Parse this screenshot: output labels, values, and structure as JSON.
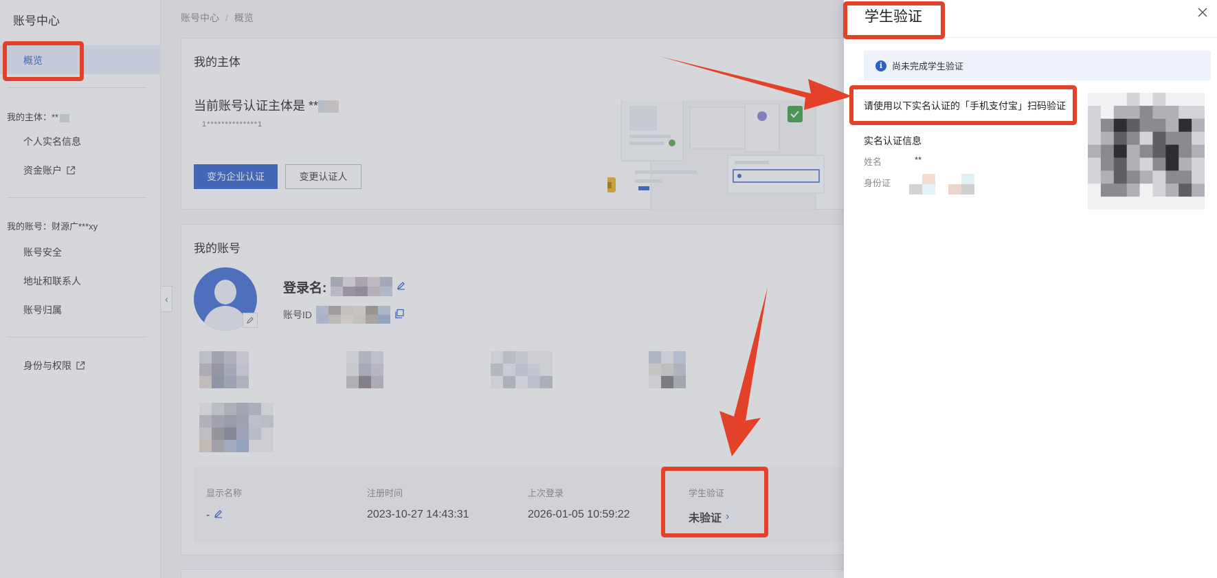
{
  "sidebar": {
    "title": "账号中心",
    "active_item": "概览",
    "subject_section": "我的主体：**",
    "subject_items": [
      "个人实名信息",
      "资金账户"
    ],
    "account_section": "我的账号：财源广***xy",
    "account_items": [
      "账号安全",
      "地址和联系人",
      "账号归属"
    ],
    "identity_item": "身份与权限",
    "collapse_icon": "chevron-left-icon"
  },
  "breadcrumb": {
    "root": "账号中心",
    "separator": "/",
    "current": "概览"
  },
  "subject_card": {
    "title": "我的主体",
    "subject_text": "当前账号认证主体是 **",
    "masked_id": "1**************1",
    "primary_button": "变为企业认证",
    "secondary_button": "变更认证人"
  },
  "account_card": {
    "title": "我的账号",
    "login_label": "登录名:",
    "account_id_label": "账号ID",
    "info": [
      {
        "label": "显示名称",
        "value": "-"
      },
      {
        "label": "注册时间",
        "value": "2023-10-27 14:43:31"
      },
      {
        "label": "上次登录",
        "value": "2026-01-05 10:59:22"
      },
      {
        "label": "学生验证",
        "value": "未验证"
      }
    ]
  },
  "drawer": {
    "title": "学生验证",
    "close_icon": "close-icon",
    "alert_text": "尚未完成学生验证",
    "instruction": "请使用以下实名认证的「手机支付宝」扫码验证",
    "section_title": "实名认证信息",
    "name_label": "姓名",
    "name_value": "**",
    "id_label": "身份证"
  },
  "colors": {
    "annotation_red": "#e4412a",
    "primary_blue": "#2f5fc9"
  }
}
